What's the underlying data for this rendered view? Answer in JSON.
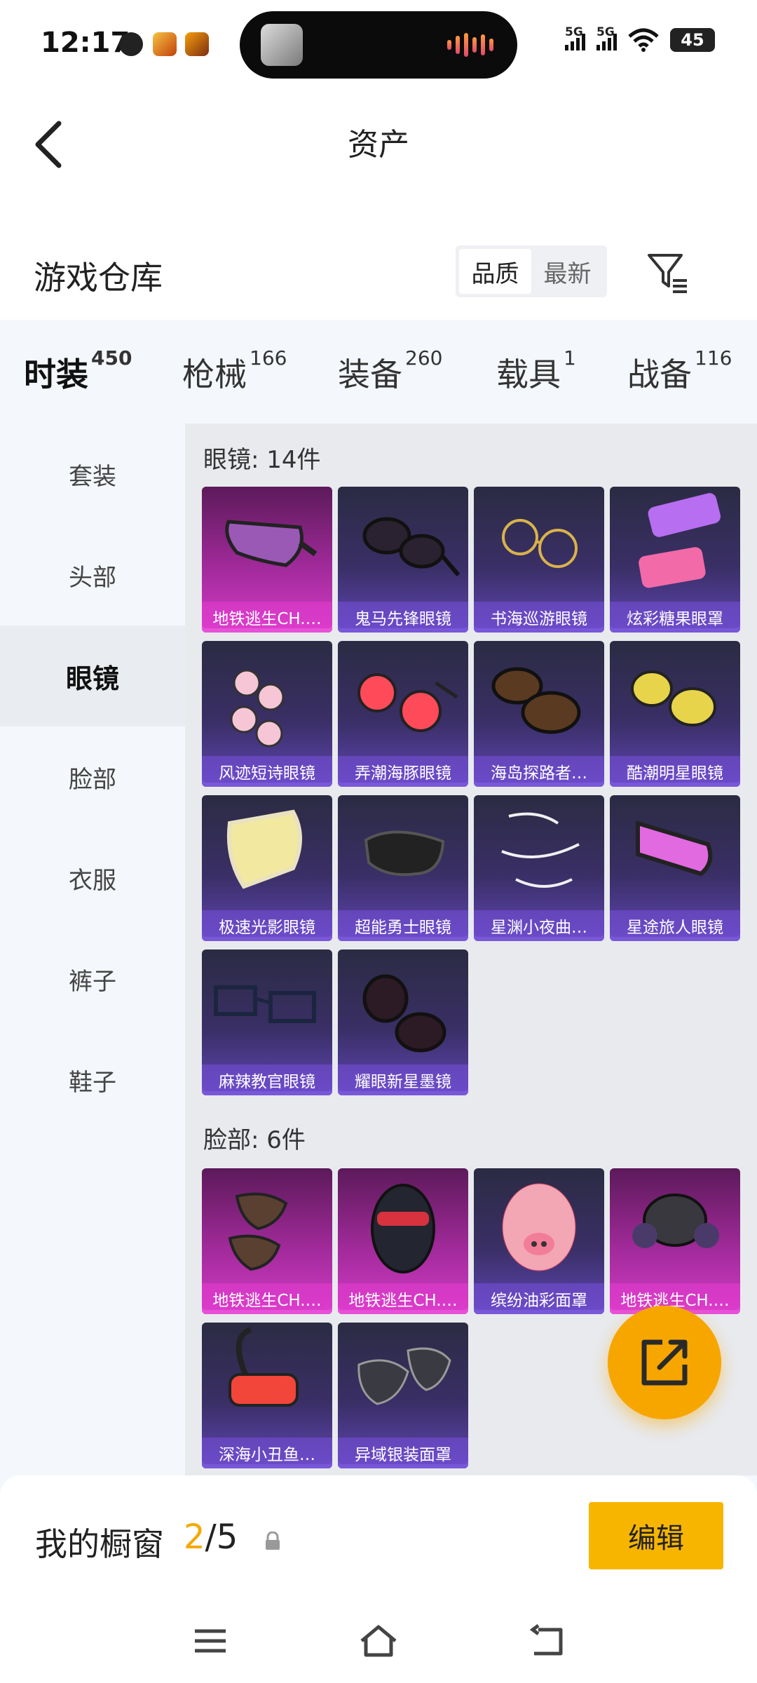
{
  "status_bar": {
    "time": "12:17",
    "signal1": "5G",
    "signal2": "5G",
    "battery": "45"
  },
  "header": {
    "title": "资产"
  },
  "warehouse": {
    "title": "游戏仓库",
    "sort_options": [
      "品质",
      "最新"
    ],
    "active_sort": "品质"
  },
  "category_tabs": [
    {
      "label": "时装",
      "count": "450",
      "active": true
    },
    {
      "label": "枪械",
      "count": "166"
    },
    {
      "label": "装备",
      "count": "260"
    },
    {
      "label": "载具",
      "count": "1"
    },
    {
      "label": "战备",
      "count": "116"
    }
  ],
  "sidebar": {
    "items": [
      "套装",
      "头部",
      "眼镜",
      "脸部",
      "衣服",
      "裤子",
      "鞋子"
    ],
    "active": "眼镜"
  },
  "sections": [
    {
      "title": "眼镜: 14件",
      "items": [
        {
          "name": "地铁逃生CH.…",
          "rarity": "purple",
          "icon": "goggles-icon"
        },
        {
          "name": "鬼马先锋眼镜",
          "rarity": "blue",
          "icon": "sunglasses-icon"
        },
        {
          "name": "书海巡游眼镜",
          "rarity": "blue",
          "icon": "round-glasses-icon"
        },
        {
          "name": "炫彩糖果眼罩",
          "rarity": "blue",
          "icon": "candy-eyemask-icon"
        },
        {
          "name": "风迹短诗眼镜",
          "rarity": "blue",
          "icon": "pink-round-glasses-icon"
        },
        {
          "name": "弄潮海豚眼镜",
          "rarity": "blue",
          "icon": "red-round-glasses-icon"
        },
        {
          "name": "海岛探路者…",
          "rarity": "blue",
          "icon": "brown-sunglasses-icon"
        },
        {
          "name": "酷潮明星眼镜",
          "rarity": "blue",
          "icon": "aviator-glasses-icon"
        },
        {
          "name": "极速光影眼镜",
          "rarity": "blue",
          "icon": "honeycomb-visor-icon"
        },
        {
          "name": "超能勇士眼镜",
          "rarity": "blue",
          "icon": "black-shades-icon"
        },
        {
          "name": "星渊小夜曲…",
          "rarity": "blue",
          "icon": "chain-glasses-icon"
        },
        {
          "name": "星途旅人眼镜",
          "rarity": "blue",
          "icon": "pink-visor-icon"
        },
        {
          "name": "麻辣教官眼镜",
          "rarity": "blue",
          "icon": "square-glasses-icon"
        },
        {
          "name": "耀眼新星墨镜",
          "rarity": "blue",
          "icon": "dark-sunglasses-icon"
        }
      ]
    },
    {
      "title": "脸部: 6件",
      "items": [
        {
          "name": "地铁逃生CH.…",
          "rarity": "purple",
          "icon": "face-mask-icon"
        },
        {
          "name": "地铁逃生CH.…",
          "rarity": "purple",
          "icon": "balaclava-icon"
        },
        {
          "name": "缤纷油彩面罩",
          "rarity": "blue",
          "icon": "pig-mask-icon"
        },
        {
          "name": "地铁逃生CH.…",
          "rarity": "purple",
          "icon": "gas-mask-icon"
        },
        {
          "name": "深海小丑鱼…",
          "rarity": "blue",
          "icon": "snorkel-mask-icon"
        },
        {
          "name": "异域银装面罩",
          "rarity": "blue",
          "icon": "silver-mask-icon"
        }
      ]
    }
  ],
  "showcase": {
    "label": "我的橱窗",
    "current": "2",
    "total": "/5",
    "edit_label": "编辑"
  },
  "colors": {
    "accent": "#f7b500",
    "card_blue": "#3a2f66",
    "card_purple": "#a12a9a"
  }
}
